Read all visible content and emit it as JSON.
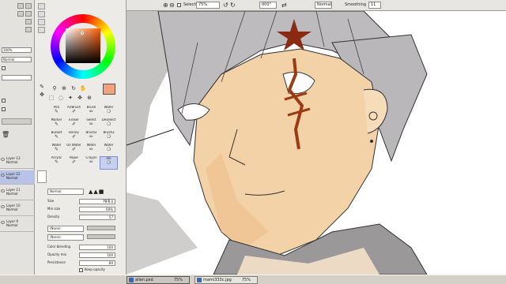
{
  "canvas_toolbar": {
    "selection_label": "Selection",
    "zoom_value": "75%",
    "rotate_value": "000°",
    "blend_value": "Normal",
    "smoothing_label": "Smoothing",
    "smoothing_value": "11"
  },
  "layer_panel": {
    "opacity_value": "100%",
    "mode_value": "Normal",
    "layers": [
      {
        "name": "Layer 13",
        "mode": "Normal",
        "selected": false
      },
      {
        "name": "Layer 12",
        "mode": "Normal",
        "selected": true
      },
      {
        "name": "Layer 11",
        "mode": "Normal",
        "selected": false
      },
      {
        "name": "Layer 10",
        "mode": "Normal",
        "selected": false
      },
      {
        "name": "Layer 9",
        "mode": "Normal",
        "selected": false
      }
    ]
  },
  "tools": {
    "brushes": [
      [
        "Pen",
        "AirBrush",
        "Brush",
        "Water"
      ],
      [
        "Marker",
        "Eraser",
        "Select",
        "Deselect"
      ],
      [
        "Bucket",
        "Binary",
        "Brush2",
        "Brush3"
      ],
      [
        "Water",
        "Oil Water",
        "Water",
        "Water"
      ],
      [
        "Acrylic",
        "Paper",
        "Crayon",
        "Ink"
      ]
    ],
    "blend_mode": "Normal",
    "params": [
      {
        "label": "Size",
        "value": "x 1.0",
        "extra": "30.0"
      },
      {
        "label": "Min size",
        "value": "60%"
      },
      {
        "label": "Density",
        "value": "57"
      }
    ],
    "dropdown_1": "(None)",
    "dropdown_2": "(None)",
    "blending_label": "Color blending",
    "blending_value": "100",
    "opacity_label": "Opacity mix",
    "opacity_value": "100",
    "persistence_label": "Persistence",
    "persistence_value": "80",
    "keep_opacity_label": "Keep opacity",
    "blur_label": "Smooth 500",
    "blur_value": "100%"
  },
  "taskbar": {
    "items": [
      {
        "label": "allen.psd",
        "zoom": "75%",
        "active": true
      },
      {
        "label": "mami333c.jpg",
        "zoom": "75%",
        "active": false
      }
    ]
  },
  "colors": {
    "current_swatch": "#f3a27c",
    "star_mark": "#8a2a12",
    "skin": "#f4d2a7"
  }
}
